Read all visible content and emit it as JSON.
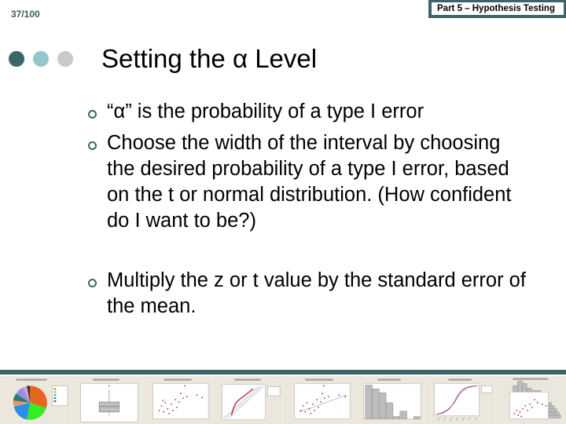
{
  "header": {
    "slide_counter": "37/100",
    "section_label": "Part 5 – Hypothesis Testing"
  },
  "decor": {
    "dot_colors": [
      "#3a6669",
      "#93c7cc",
      "#c9c9c9"
    ],
    "accent": "#3d6466"
  },
  "slide": {
    "title": "Setting the α Level",
    "bullets": [
      {
        "icon": "hollow-circle-bullet",
        "text": "“α” is the probability of a type I error"
      },
      {
        "icon": "hollow-circle-bullet",
        "text": "Choose the width of the interval by choosing the desired probability of a type I error, based on the t or normal distribution. (How confident do I want to be?)"
      },
      {
        "icon": "hollow-circle-bullet",
        "text": "Multiply the z or t value by the standard error of the mean."
      }
    ]
  },
  "footer": {
    "thumbnails": [
      {
        "kind": "pie-chart"
      },
      {
        "kind": "boxplot"
      },
      {
        "kind": "scatterplot"
      },
      {
        "kind": "probability-plot"
      },
      {
        "kind": "scatterplot-with-fit"
      },
      {
        "kind": "histogram"
      },
      {
        "kind": "empirical-cdf"
      },
      {
        "kind": "marginal-plot"
      }
    ]
  }
}
